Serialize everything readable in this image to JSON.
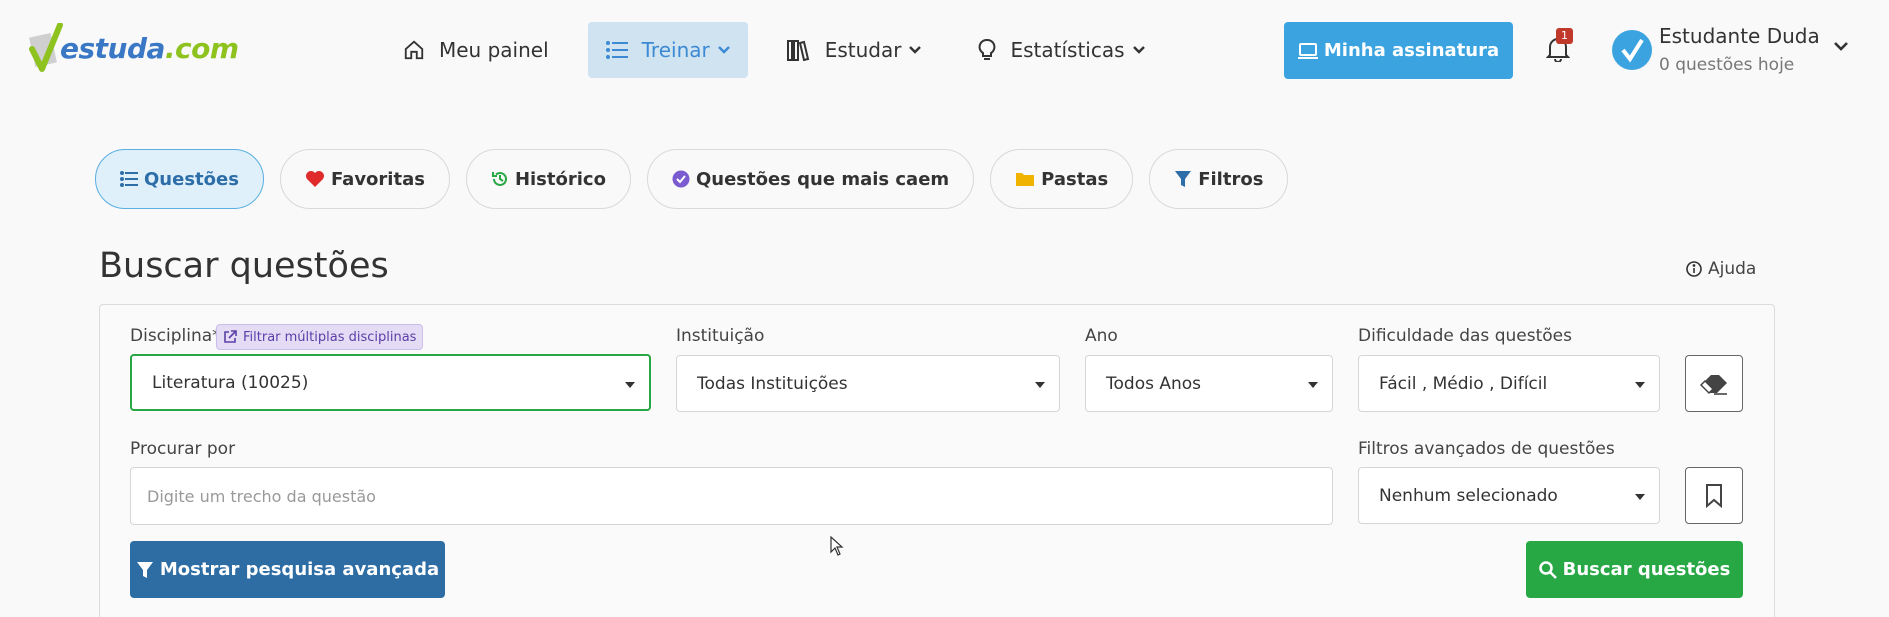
{
  "brand": {
    "name_main": "estuda",
    "name_suffix": ".com"
  },
  "nav": {
    "items": [
      {
        "label": "Meu painel",
        "icon": "home-icon"
      },
      {
        "label": "Treinar",
        "icon": "list-icon",
        "active": true
      },
      {
        "label": "Estudar",
        "icon": "books-icon"
      },
      {
        "label": "Estatísticas",
        "icon": "lightbulb-icon"
      }
    ]
  },
  "header": {
    "subscription_label": "Minha assinatura",
    "notification_count": "1",
    "user_name": "Estudante Duda",
    "user_sub": "0 questões hoje"
  },
  "tabs": [
    {
      "label": "Questões",
      "icon": "list-icon",
      "active": true
    },
    {
      "label": "Favoritas",
      "icon": "heart-icon"
    },
    {
      "label": "Histórico",
      "icon": "history-icon"
    },
    {
      "label": "Questões que mais caem",
      "icon": "check-circle-icon"
    },
    {
      "label": "Pastas",
      "icon": "folder-icon"
    },
    {
      "label": "Filtros",
      "icon": "filter-icon"
    }
  ],
  "page": {
    "title": "Buscar questões",
    "help_label": "Ajuda"
  },
  "form": {
    "disciplina": {
      "label": "Disciplina*",
      "value": "Literatura (10025)",
      "chip": "Filtrar múltiplas disciplinas"
    },
    "instituicao": {
      "label": "Instituição",
      "value": "Todas Instituições"
    },
    "ano": {
      "label": "Ano",
      "value": "Todos Anos"
    },
    "dificuldade": {
      "label": "Dificuldade das questões",
      "value": "Fácil , Médio , Difícil"
    },
    "procurar": {
      "label": "Procurar por",
      "placeholder": "Digite um trecho da questão"
    },
    "filtros_avancados": {
      "label": "Filtros avançados de questões",
      "value": "Nenhum selecionado"
    },
    "advanced_button": "Mostrar pesquisa avançada",
    "search_button": "Buscar questões"
  },
  "colors": {
    "primary": "#3aa3e0",
    "nav_active_bg": "#cfe3f1",
    "adv_button": "#2e6da4",
    "search_button": "#28a745",
    "badge": "#c0392b"
  }
}
